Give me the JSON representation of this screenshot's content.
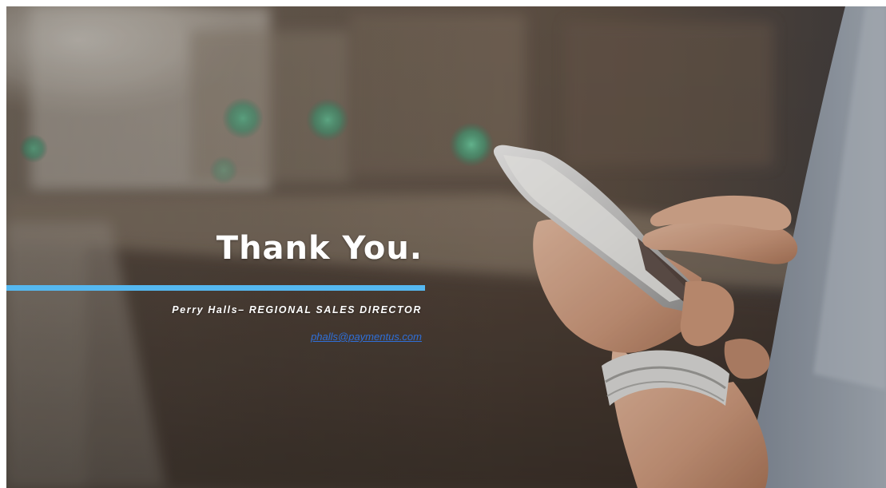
{
  "slide": {
    "title": "Thank You.",
    "presenter_name": "Perry Halls",
    "presenter_separator": "– ",
    "presenter_role": "REGIONAL SALES DIRECTOR",
    "email": "phalls@paymentus.com"
  },
  "colors": {
    "accent_bar": "#55b8f0",
    "email_link": "#2f6fd8",
    "title_text": "#ffffff"
  }
}
